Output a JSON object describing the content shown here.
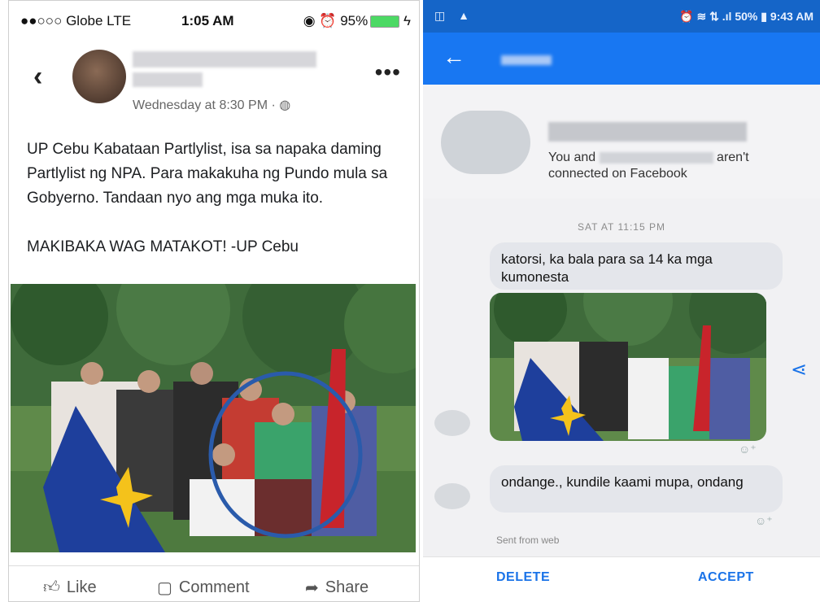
{
  "facebook": {
    "status_bar": {
      "carrier": "●●○○○ Globe  LTE",
      "time": "1:05 AM",
      "right": "◉  ⏰  95%"
    },
    "post_time": "Wednesday at 8:30 PM · ",
    "post_text": "UP Cebu Kabataan Partlylist, isa sa napaka daming Partlylist ng NPA. Para makakuha ng Pundo mula sa Gobyerno. Tandaan nyo ang mga muka ito.\n\nMAKIBAKA WAG MATAKOT!  -UP Cebu",
    "actions": {
      "like": "Like",
      "comment": "Comment",
      "share": "Share"
    },
    "colors": {
      "circle": "#2a5bab"
    }
  },
  "messenger": {
    "status_bar": {
      "left": "◫ ▲",
      "right": "⏰ ≋ ⇅ .ıl 50% ▮ 9:43 AM"
    },
    "profile_note_start": "You and",
    "profile_note_end": "aren't",
    "profile_note_line2": "connected on Facebook",
    "day_label": "SAT AT 11:15 PM",
    "messages": [
      {
        "text": "katorsi, ka bala para sa 14 ka mga kumonesta"
      },
      {
        "text": "ondange., kundile kaami mupa, ondang"
      }
    ],
    "sent_from": "Sent from web",
    "buttons": {
      "delete": "DELETE",
      "accept": "ACCEPT"
    },
    "colors": {
      "header": "#1877f2",
      "status": "#1565c8"
    }
  }
}
